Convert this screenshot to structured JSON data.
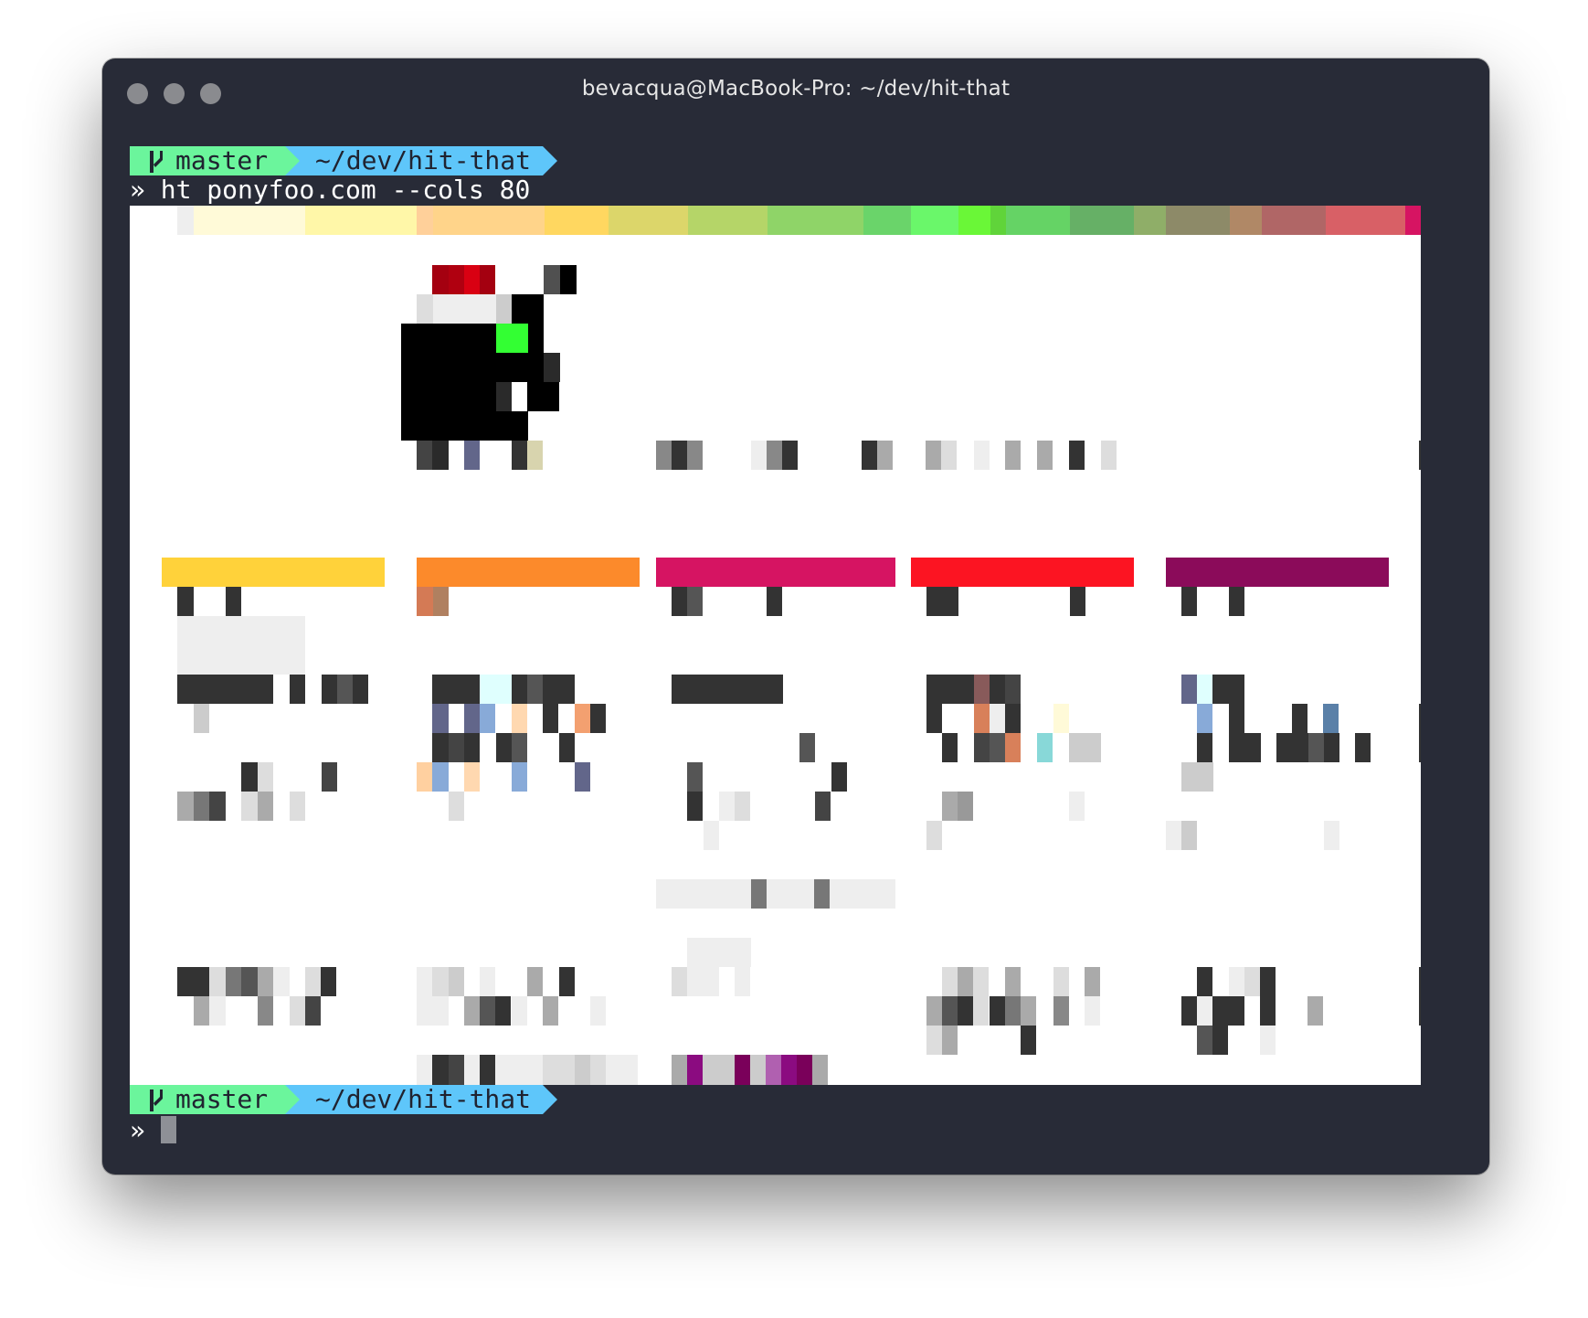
{
  "window": {
    "title": "bevacqua@MacBook-Pro: ~/dev/hit-that",
    "traffic_light_color": "#8a8b8f",
    "background": "#282b37"
  },
  "prompt": {
    "branch": "master",
    "path": "~/dev/hit-that",
    "branch_icon": "git-branch-icon",
    "branch_color": "#6bf59c",
    "path_color": "#5ec6fa"
  },
  "command": {
    "symbol": "»",
    "text": "ht ponyfoo.com --cols 80"
  },
  "prompt_after": {
    "branch": "master",
    "path": "~/dev/hit-that",
    "symbol": "»"
  },
  "colors": {
    "yellow": "#ffd23a",
    "orange": "#fc8a2b",
    "pink": "#d61462",
    "red": "#fc1422",
    "purple": "#8b0b5a",
    "dark": "#303030"
  }
}
